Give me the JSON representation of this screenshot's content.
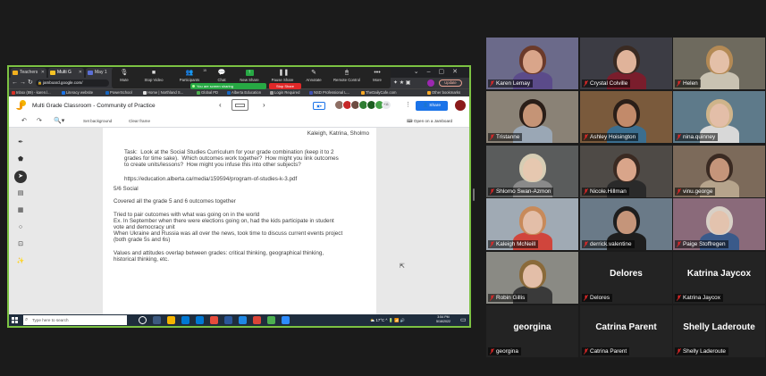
{
  "browser": {
    "tabs": [
      {
        "label": "Teachers",
        "color": "#f2b01e"
      },
      {
        "label": "Multi G",
        "color": "#f7c325"
      },
      {
        "label": "May 1",
        "color": "#5b6fd6"
      }
    ],
    "url": "jamboard.google.com/",
    "update_label": "Update",
    "bookmarks": [
      {
        "label": "Inbox (89) - karen.l...",
        "color": "#d93025"
      },
      {
        "label": "Literacy website",
        "color": "#1a73e8"
      },
      {
        "label": "PowerSchool",
        "color": "#1565c0"
      },
      {
        "label": "Home | Northland S...",
        "color": "#e0e0e0"
      },
      {
        "label": "Global PD",
        "color": "#4caf50"
      },
      {
        "label": "Alberta Education",
        "color": "#1565c0"
      },
      {
        "label": "Login Required",
        "color": "#9e9e9e"
      },
      {
        "label": "NSD Professional L...",
        "color": "#3f51b5"
      },
      {
        "label": "TheDailyCafe.com",
        "color": "#f9a825"
      },
      {
        "label": "Other bookmarks",
        "color": "#f9a825"
      }
    ]
  },
  "zoom_toolbar": {
    "items": [
      "Mute",
      "Stop Video",
      "Participants",
      "Chat",
      "New Share",
      "Pause Share",
      "Annotate",
      "Remote Control",
      "More"
    ],
    "participants_count": "15",
    "sharing_text": "You are screen sharing",
    "stop_share_label": "Stop Share"
  },
  "jamboard": {
    "title": "Multi Grade Classroom - Community of Practice",
    "share_label": "Share",
    "avatar_overflow": "+11",
    "set_background": "Set background",
    "clear_frame": "Clear frame",
    "open_cta": "Open on a Jamboard",
    "names_line": "Kaleigh, Katrina, Sholmo",
    "task": "Task:  Look at the Social Studies Curriculum for your grade combination (keep it to 2\ngrades for time sake).  Which outcomes work together?  How might you link outcomes\nto create units/lessons?  How might you infuse this into other subjects?",
    "link": "https://education.alberta.ca/media/159594/program-of-studies-k-3.pdf",
    "body": "5/6 Social\n\nCovered all the grade 5 and 6 outcomes together\n\nTried to pair outcomes with what was going on in the world\nEx. In September when there were elections going on, had the kids participate in student\nvote and democracy unit\nWhen Ukraine and Russia was all over the news, took time to discuss current events project\n(both grade 5s and 6s)\n\nValues and attitudes overlap between grades: critical thinking, geographical thinking,\nhistorical thinking, etc."
  },
  "taskbar": {
    "search_placeholder": "Type here to search",
    "weather": "17°C",
    "time": "3:54 PM",
    "date": "5/16/2022"
  },
  "participants": [
    "Karen Lemay",
    "Crystal Colville",
    "Helen",
    "Tristanne",
    "Ashley Hoisington",
    "nina.quinney",
    "Shlomo Swan-Azmon",
    "Nicole.Hillman",
    "vinu.george",
    "Kaleigh McNeill",
    "derrick.valentine",
    "Paige Stoffregen",
    "Robin Gillis",
    "Delores",
    "Katrina Jaycox",
    "georgina",
    "Catrina Parent",
    "Shelly Laderoute"
  ],
  "colors": {
    "share_border": "#7cc242",
    "active_speaker": "#d9cf2a",
    "muted_mic": "#e02828",
    "accent": "#1a73e8"
  }
}
